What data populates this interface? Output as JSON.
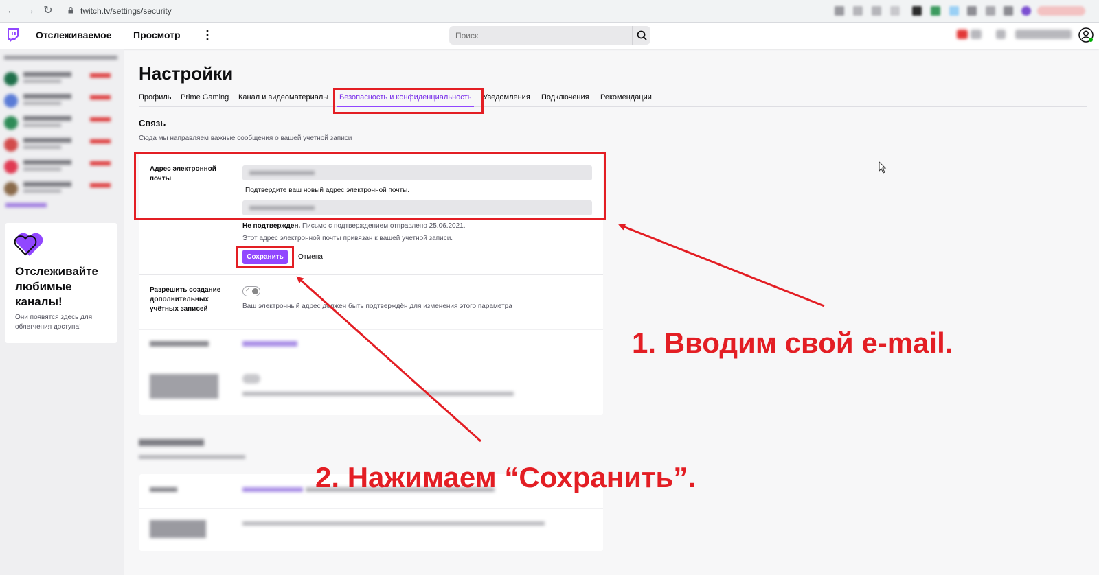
{
  "browser": {
    "url": "twitch.tv/settings/security",
    "icons": [
      "back-icon",
      "forward-icon",
      "reload-icon",
      "lock-icon"
    ]
  },
  "topnav": {
    "following": "Отслеживаемое",
    "browse": "Просмотр",
    "more": "⋮",
    "search_placeholder": "Поиск"
  },
  "sidebar": {
    "card_title": "Отслеживайте любимые каналы!",
    "card_subtitle": "Они появятся здесь для облегчения доступа!"
  },
  "page": {
    "title": "Настройки",
    "tabs": [
      {
        "label": "Профиль"
      },
      {
        "label": "Prime Gaming"
      },
      {
        "label": "Канал и видеоматериалы"
      },
      {
        "label": "Безопасность и конфиденциальность"
      },
      {
        "label": "Уведомления"
      },
      {
        "label": "Подключения"
      },
      {
        "label": "Рекомендации"
      }
    ],
    "active_tab": "Безопасность и конфиденциальность"
  },
  "contact": {
    "section_title": "Связь",
    "section_subtitle": "Сюда мы направляем важные сообщения о вашей учетной записи",
    "email_label": "Адрес электронной почты",
    "confirm_prompt": "Подтвердите ваш новый адрес электронной почты.",
    "not_verified_bold": "Не подтвержден.",
    "not_verified_rest": " Письмо с подтверждением отправлено 25.06.2021.",
    "linked_note": "Этот адрес электронной почты привязан к вашей учетной записи.",
    "save": "Сохранить",
    "cancel": "Отмена",
    "allow_label": "Разрешить создание дополнительных учётных записей",
    "allow_note": "Ваш электронный адрес должен быть подтверждён для изменения этого параметра"
  },
  "annotations": {
    "step1": "1. Вводим свой e-mail.",
    "step2": "2. Нажимаем “Сохранить”.",
    "color": "#e31e24"
  },
  "colors": {
    "accent": "#9147ff",
    "active_tab": "#772ce8"
  }
}
